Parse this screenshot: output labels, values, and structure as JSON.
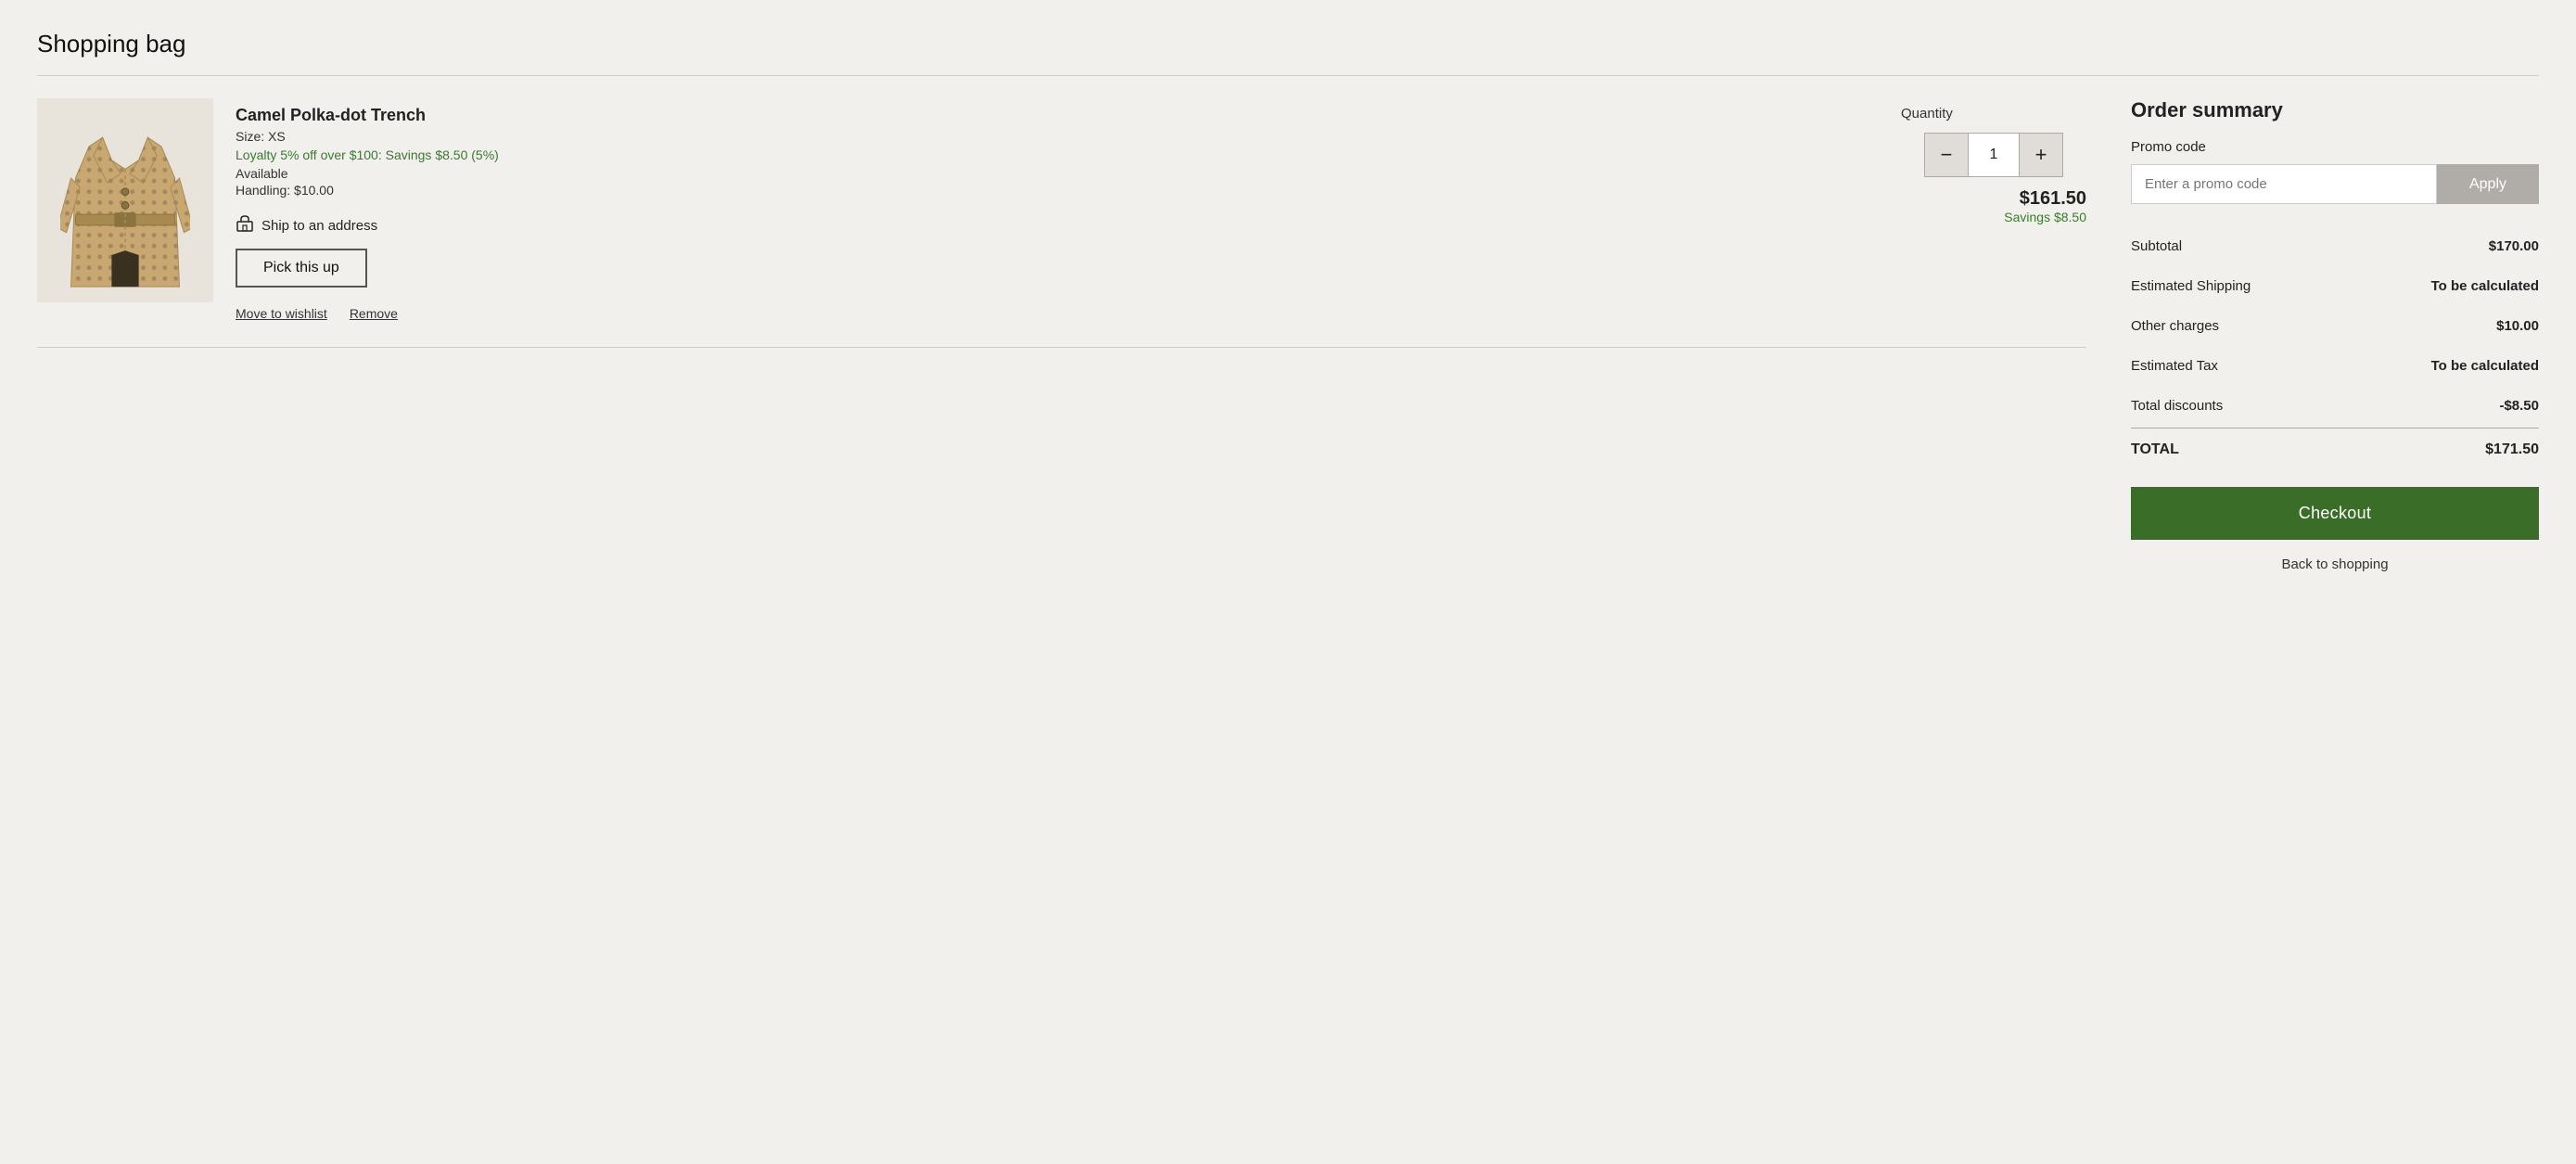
{
  "page": {
    "title": "Shopping bag"
  },
  "cart": {
    "item": {
      "name": "Camel Polka-dot Trench",
      "size_label": "Size: XS",
      "loyalty_text": "Loyalty 5% off over $100: Savings $8.50 (5%)",
      "available": "Available",
      "handling": "Handling: $10.00",
      "ship_label": "Ship to an address",
      "pickup_btn": "Pick this up",
      "quantity_label": "Quantity",
      "quantity": "1",
      "price": "$161.50",
      "savings": "Savings $8.50",
      "move_wishlist": "Move to wishlist",
      "remove": "Remove"
    }
  },
  "order_summary": {
    "title": "Order summary",
    "promo_label": "Promo code",
    "promo_placeholder": "Enter a promo code",
    "apply_btn": "Apply",
    "rows": [
      {
        "label": "Subtotal",
        "value": "$170.00",
        "bold": true
      },
      {
        "label": "Estimated Shipping",
        "value": "To be calculated",
        "bold": false
      },
      {
        "label": "Other charges",
        "value": "$10.00",
        "bold": true
      },
      {
        "label": "Estimated Tax",
        "value": "To be calculated",
        "bold": false
      },
      {
        "label": "Total discounts",
        "value": "-$8.50",
        "bold": true
      }
    ],
    "total_label": "TOTAL",
    "total_value": "$171.50",
    "checkout_btn": "Checkout",
    "back_to_shopping": "Back to shopping"
  },
  "icons": {
    "minus": "−",
    "plus": "+",
    "ship": "🏠"
  }
}
